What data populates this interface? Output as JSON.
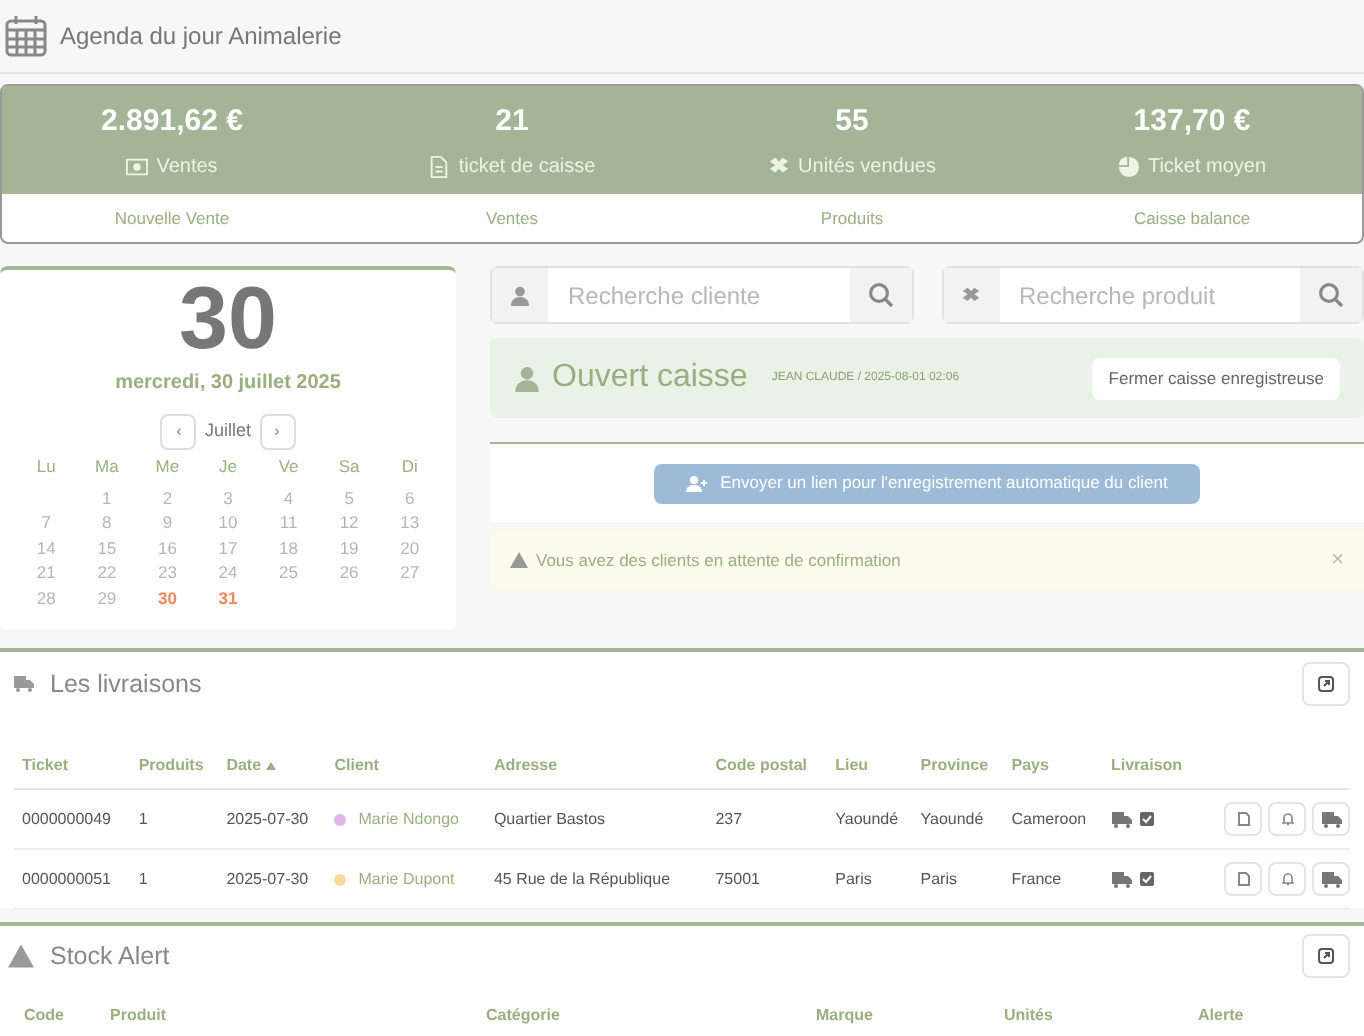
{
  "header": {
    "title": "Agenda du jour Animalerie"
  },
  "stats": [
    {
      "value": "2.891,62 €",
      "label": "Ventes",
      "kind": "money"
    },
    {
      "value": "21",
      "label": "ticket de caisse",
      "kind": "file"
    },
    {
      "value": "55",
      "label": "Unités vendues",
      "kind": "box"
    },
    {
      "value": "137,70 €",
      "label": "Ticket moyen",
      "kind": "pie"
    }
  ],
  "links": [
    "Nouvelle Vente",
    "Ventes",
    "Produits",
    "Caisse balance"
  ],
  "calendar": {
    "day": "30",
    "date": "mercredi, 30 juillet 2025",
    "prev": "‹",
    "month": "Juillet",
    "next": "›",
    "weekdays": [
      "Lu",
      "Ma",
      "Me",
      "Je",
      "Ve",
      "Sa",
      "Di"
    ],
    "days": [
      {
        "label": "1",
        "highlighted": false
      },
      {
        "label": "2",
        "highlighted": false
      },
      {
        "label": "3",
        "highlighted": false
      },
      {
        "label": "4",
        "highlighted": false
      },
      {
        "label": "5",
        "highlighted": false
      },
      {
        "label": "6",
        "highlighted": false
      },
      {
        "label": "7",
        "highlighted": false
      },
      {
        "label": "8",
        "highlighted": false
      },
      {
        "label": "9",
        "highlighted": false
      },
      {
        "label": "10",
        "highlighted": false
      },
      {
        "label": "11",
        "highlighted": false
      },
      {
        "label": "12",
        "highlighted": false
      },
      {
        "label": "13",
        "highlighted": false
      },
      {
        "label": "14",
        "highlighted": false
      },
      {
        "label": "15",
        "highlighted": false
      },
      {
        "label": "16",
        "highlighted": false
      },
      {
        "label": "17",
        "highlighted": false
      },
      {
        "label": "18",
        "highlighted": false
      },
      {
        "label": "19",
        "highlighted": false
      },
      {
        "label": "20",
        "highlighted": false
      },
      {
        "label": "21",
        "highlighted": false
      },
      {
        "label": "22",
        "highlighted": false
      },
      {
        "label": "23",
        "highlighted": false
      },
      {
        "label": "24",
        "highlighted": false
      },
      {
        "label": "25",
        "highlighted": false
      },
      {
        "label": "26",
        "highlighted": false
      },
      {
        "label": "27",
        "highlighted": false
      },
      {
        "label": "28",
        "highlighted": false
      },
      {
        "label": "29",
        "highlighted": false
      },
      {
        "label": "30",
        "highlighted": true
      },
      {
        "label": "31",
        "highlighted": true
      }
    ]
  },
  "searches": [
    {
      "kind": "client",
      "placeholder": "Recherche cliente"
    },
    {
      "kind": "product",
      "placeholder": "Recherche produit"
    }
  ],
  "register": {
    "title": "Ouvert caisse",
    "info": "JEAN CLAUDE / 2025-08-01 02:06",
    "button": "Fermer caisse enregistreuse"
  },
  "invite_button": "Envoyer un lien pour l'enregistrement  automatique du client",
  "alert": {
    "text": "Vous avez des clients en attente de confirmation",
    "close": "×"
  },
  "deliveries": {
    "title": "Les livraisons",
    "columns": [
      {
        "label": "Ticket",
        "sorted": false
      },
      {
        "label": "Produits",
        "sorted": false
      },
      {
        "label": "Date",
        "sorted": true
      },
      {
        "label": "Client",
        "sorted": false
      },
      {
        "label": "Adresse",
        "sorted": false
      },
      {
        "label": "Code postal",
        "sorted": false
      },
      {
        "label": "Lieu",
        "sorted": false
      },
      {
        "label": "Province",
        "sorted": false
      },
      {
        "label": "Pays",
        "sorted": false
      },
      {
        "label": "Livraison",
        "sorted": false
      }
    ],
    "rows": [
      {
        "ticket": "0000000049",
        "products": "1",
        "date": "2025-07-30",
        "client": "Marie Ndongo",
        "color": "#e3b5ea",
        "address": "Quartier Bastos",
        "postal_code": "237",
        "place": "Yaoundé",
        "province": "Yaoundé",
        "country": "Cameroon",
        "delivered": true
      },
      {
        "ticket": "0000000051",
        "products": "1",
        "date": "2025-07-30",
        "client": "Marie Dupont",
        "color": "#f5dc9a",
        "address": "45 Rue de la République",
        "postal_code": "75001",
        "place": "Paris",
        "province": "Paris",
        "country": "France",
        "delivered": true
      }
    ]
  },
  "stock_alert": {
    "title": "Stock Alert",
    "columns": [
      "Code",
      "Produit",
      "Catégorie",
      "Marque",
      "Unités",
      "Alerte"
    ]
  }
}
